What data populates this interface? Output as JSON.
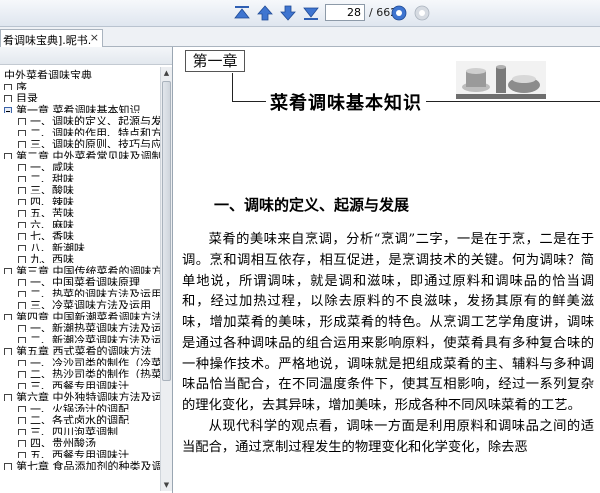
{
  "toolbar": {
    "current_page": "28",
    "total_pages": "/ 662"
  },
  "tab": {
    "title": "肴调味宝典].昵书....",
    "close": "×"
  },
  "toc": {
    "items": [
      {
        "text": "中外菜肴调味宝典",
        "level": 0
      },
      {
        "text": "序",
        "level": 1
      },
      {
        "text": "目录",
        "level": 1
      },
      {
        "text": "第一章  菜肴调味基本知识",
        "level": 1,
        "expanded": true
      },
      {
        "text": "一、调味的定义、起源与发",
        "level": 2
      },
      {
        "text": "二、调味的作用、特点和方",
        "level": 2
      },
      {
        "text": "三、调味的原则、技巧与应",
        "level": 2
      },
      {
        "text": "第二章  中外菜肴常见味及调制",
        "level": 1
      },
      {
        "text": "一、咸味",
        "level": 2
      },
      {
        "text": "二、甜味",
        "level": 2
      },
      {
        "text": "三、酸味",
        "level": 2
      },
      {
        "text": "四、辣味",
        "level": 2
      },
      {
        "text": "五、苦味",
        "level": 2
      },
      {
        "text": "六、麻味",
        "level": 2
      },
      {
        "text": "七、香味",
        "level": 2
      },
      {
        "text": "八、新潮味",
        "level": 2
      },
      {
        "text": "九、西味",
        "level": 2
      },
      {
        "text": "第三章  中国传统菜肴的调味方",
        "level": 1
      },
      {
        "text": "一、中国菜肴调味原理",
        "level": 2
      },
      {
        "text": "二、热菜的调味方法及运用",
        "level": 2
      },
      {
        "text": "三、冷菜调味方法及运用",
        "level": 2
      },
      {
        "text": "第四章  中国新潮菜肴调味方法",
        "level": 1
      },
      {
        "text": "一、新潮热菜调味方法及运",
        "level": 2
      },
      {
        "text": "二、新潮冷菜调味方法及运",
        "level": 2
      },
      {
        "text": "第五章  西式菜肴的调味方法",
        "level": 1
      },
      {
        "text": "一、冷沙司类的制作（冷菜",
        "level": 2
      },
      {
        "text": "二、热沙司类的制作（热菜",
        "level": 2
      },
      {
        "text": "三、西餐专用调味汁",
        "level": 2
      },
      {
        "text": "第六章  中外独特调味方法及运",
        "level": 1
      },
      {
        "text": "一、火锅汤汁的调配",
        "level": 2
      },
      {
        "text": "二、各式卤水的调配",
        "level": 2
      },
      {
        "text": "三、四川泡菜调制",
        "level": 2
      },
      {
        "text": "四、贵州酸汤",
        "level": 2
      },
      {
        "text": "五、西餐专用调味汁",
        "level": 2
      },
      {
        "text": "第七章  食品添加剂的种类及调",
        "level": 1
      }
    ]
  },
  "document": {
    "chapter_label": "第一章",
    "chapter_title": "菜肴调味基本知识",
    "section_title": "一、调味的定义、起源与发展",
    "paragraphs": [
      "菜肴的美味来自烹调，分析“烹调”二字，一是在于烹，二是在于调。烹和调相互依存，相互促进，是烹调技术的关键。何为调味？简单地说，所谓调味，就是调和滋味，即通过原料和调味品的恰当调和，经过加热过程，以除去原料的不良滋味，发扬其原有的鲜美滋味，增加菜肴的美味，形成菜肴的特色。从烹调工艺学角度讲，调味是通过各种调味品的组合运用来影响原料，使菜肴具有多种复合味的一种操作技术。严格地说，调味就是把组成菜肴的主、辅料与多种调味品恰当配合，在不同温度条件下，使其互相影响，经过一系列复杂的理化变化，去其异味，增加美味，形成各种不同风味菜肴的工艺。",
      "从现代科学的观点看，调味一方面是利用原料和调味品之间的适当配合，通过烹制过程发生的物理变化和化学变化，除去恶"
    ]
  }
}
